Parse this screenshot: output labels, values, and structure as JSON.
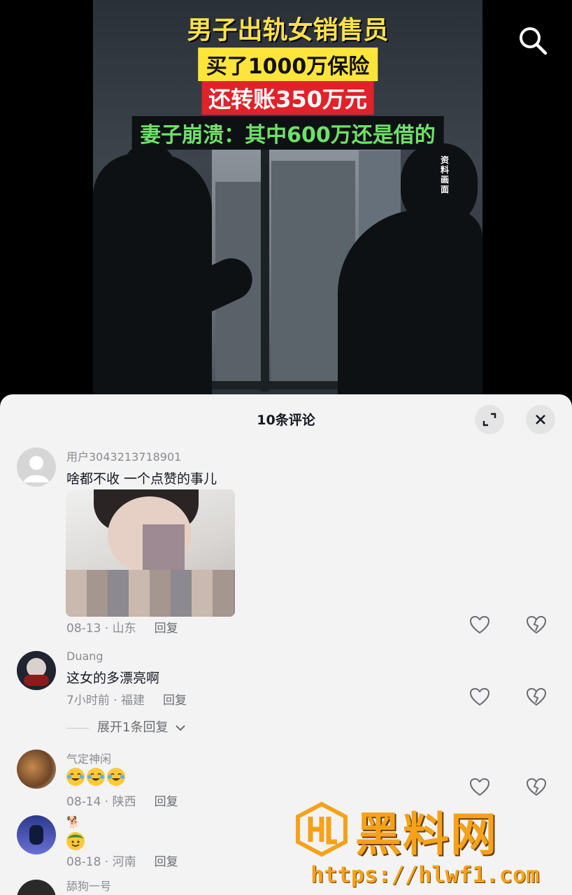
{
  "video": {
    "caption_lines": [
      "男子出轨女销售员",
      "买了1000万保险",
      "还转账350万元",
      "妻子崩溃：其中600万还是借的"
    ],
    "side_note": "资料画面",
    "search_icon": "search-icon"
  },
  "comments_panel": {
    "title": "10条评论",
    "expand_icon": "expand-icon",
    "close_icon": "close-icon"
  },
  "comments": [
    {
      "user": "用户3043213718901",
      "text": "啥都不收 一个点赞的事儿",
      "date": "08-13",
      "location": "山东",
      "reply": "回复",
      "has_image": true
    },
    {
      "user": "Duang",
      "text": "这女的多漂亮啊",
      "date": "7小时前",
      "location": "福建",
      "reply": "回复",
      "expand": "展开1条回复"
    },
    {
      "user": "气定神闲",
      "text": "",
      "emoji": [
        "laughing-crying-emoji",
        "laughing-crying-emoji",
        "laughing-crying-emoji"
      ],
      "date": "08-14",
      "location": "陕西",
      "reply": "回复"
    },
    {
      "user": "🐕",
      "text": "",
      "emoji": [
        "cowboy-emoji"
      ],
      "date": "08-18",
      "location": "河南",
      "reply": "回复"
    },
    {
      "user": "舔狗一号"
    }
  ],
  "watermark": {
    "title": "黑料网",
    "url": "https://hlwf1.com",
    "logo_icon": "hl-logo-icon"
  },
  "colors": {
    "sheet_bg": "#f3f3f3",
    "caption_yellow": "#ffe53b",
    "caption_red": "#e0222a",
    "caption_green": "#6fe06a",
    "watermark": "#f5a21a"
  }
}
